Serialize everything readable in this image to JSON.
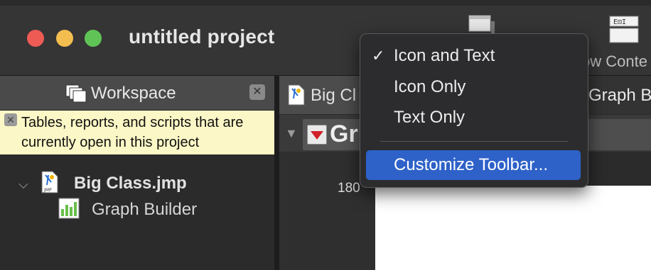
{
  "window": {
    "title": "untitled project",
    "toolbar_partial_label": "ow Conte"
  },
  "workspace": {
    "title": "Workspace",
    "close_glyph": "✕",
    "note": "Tables, reports, and scripts that are currently open in this project",
    "note_close_glyph": "✕",
    "tree": {
      "file_label": "Big Class.jmp",
      "child_label": "Graph Builder"
    }
  },
  "tabs": [
    {
      "label": "Big Cl"
    },
    {
      "label": "Graph B"
    }
  ],
  "report": {
    "title_partial": "Gr",
    "axis_value": "180"
  },
  "context_menu": {
    "items": [
      {
        "label": "Icon and Text",
        "checked": "✓"
      },
      {
        "label": "Icon Only"
      },
      {
        "label": "Text Only"
      },
      {
        "label": "Customize Toolbar..."
      }
    ]
  },
  "icons": [
    "workspace-icon",
    "jmp-file-icon",
    "graph-builder-icon",
    "disclosure-triangle-icon",
    "toolbar-icon"
  ],
  "colors": {
    "highlight": "#2e62c9",
    "note_bg": "#fbf7c6",
    "close": "#ee5b55",
    "minimize": "#f3be4f",
    "zoom": "#5fc455"
  }
}
